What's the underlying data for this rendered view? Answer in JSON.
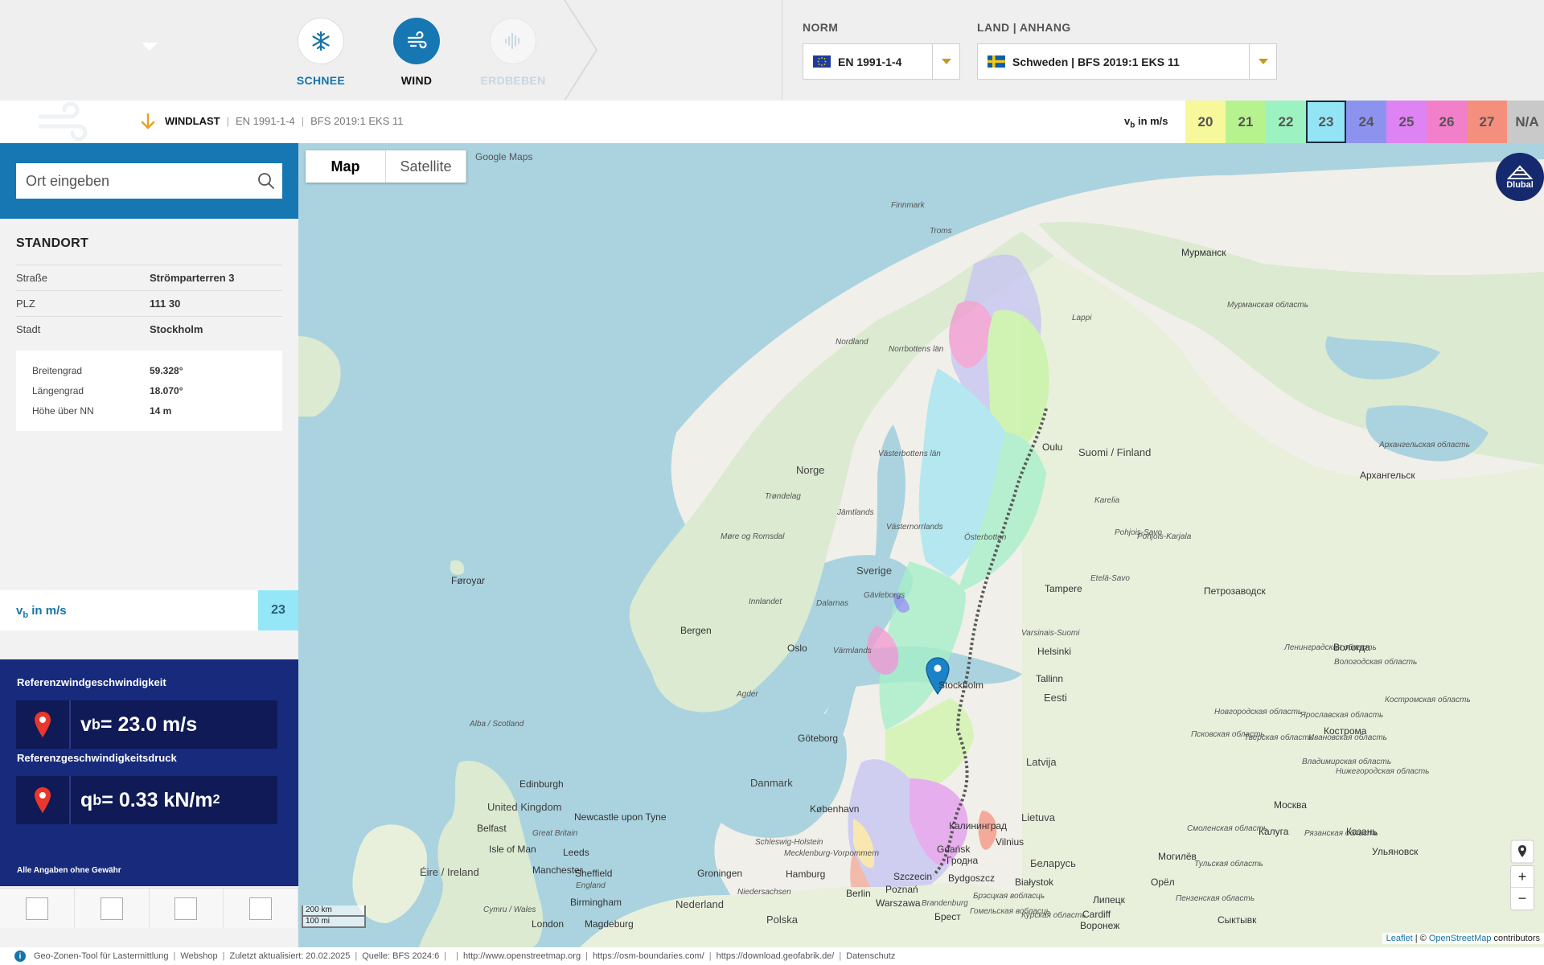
{
  "hazards": [
    {
      "label": "SCHNEE",
      "icon": "snowflake-icon",
      "state": "inactive"
    },
    {
      "label": "WIND",
      "icon": "wind-icon",
      "state": "active"
    },
    {
      "label": "ERDBEBEN",
      "icon": "seismic-icon",
      "state": "disabled"
    }
  ],
  "norm": {
    "caption": "NORM",
    "value": "EN 1991-1-4",
    "flag": "eu-flag-icon"
  },
  "land": {
    "caption": "LAND | ANHANG",
    "value": "Schweden | BFS 2019:1 EKS 11",
    "flag": "sweden-flag-icon"
  },
  "subbar": {
    "title": "WINDLAST",
    "norm": "EN 1991-1-4",
    "annex": "BFS 2019:1 EKS 11",
    "legend_label_v": "v",
    "legend_label_sub": "b",
    "legend_label_unit": " in m/s",
    "legend": [
      {
        "value": "20",
        "color": "#f7f79b"
      },
      {
        "value": "21",
        "color": "#b6f38f"
      },
      {
        "value": "22",
        "color": "#9cf2c0"
      },
      {
        "value": "23",
        "color": "#93e4f5",
        "selected": true
      },
      {
        "value": "24",
        "color": "#8c93ef"
      },
      {
        "value": "25",
        "color": "#de83f3"
      },
      {
        "value": "26",
        "color": "#f27fc9"
      },
      {
        "value": "27",
        "color": "#f48f7d"
      },
      {
        "value": "N/A",
        "color": "#c9c9c9"
      }
    ]
  },
  "search": {
    "placeholder": "Ort eingeben"
  },
  "standort": {
    "title": "STANDORT",
    "address": [
      {
        "key": "Straße",
        "value": "Strömparterren 3"
      },
      {
        "key": "PLZ",
        "value": "111 30"
      },
      {
        "key": "Stadt",
        "value": "Stockholm"
      }
    ],
    "coords": [
      {
        "key": "Breitengrad",
        "value": "59.328°"
      },
      {
        "key": "Längengrad",
        "value": "18.070°"
      },
      {
        "key": "Höhe über NN",
        "value": "14 m"
      }
    ]
  },
  "vb_row": {
    "label_v": "v",
    "label_sub": "b",
    "label_unit": " in m/s",
    "value": "23"
  },
  "results": {
    "title1": "Referenzwindgeschwindigkeit",
    "f1_sym": "v",
    "f1_sub": "b",
    "f1_rest": " = 23.0 m/s",
    "title2": "Referenzgeschwindigkeitsdruck",
    "f2_sym": "q",
    "f2_sub": "b",
    "f2_rest": " = 0.33 kN/m",
    "f2_sup": "2",
    "note": "Alle Angaben ohne Gewähr"
  },
  "map": {
    "tab_map": "Map",
    "tab_sat": "Satellite",
    "google": "Google Maps",
    "dlubal": "Dlubal",
    "scale_km": "200 km",
    "scale_mi": "100 mi",
    "attrib_leaflet": "Leaflet",
    "attrib_sep": " | © ",
    "attrib_osm": "OpenStreetMap",
    "attrib_rest": " contributors",
    "zoom_in": "+",
    "zoom_out": "−",
    "places": [
      {
        "name": "Finnmark",
        "cls": "italic"
      },
      {
        "name": "Troms",
        "cls": "italic"
      },
      {
        "name": "Мурманск",
        "cls": ""
      },
      {
        "name": "Мурманская область",
        "cls": "italic"
      },
      {
        "name": "Lappi",
        "cls": "italic"
      },
      {
        "name": "Nordland",
        "cls": "italic"
      },
      {
        "name": "Norrbottens län",
        "cls": "italic"
      },
      {
        "name": "Oulu",
        "cls": ""
      },
      {
        "name": "Suomi / Finland",
        "cls": "country"
      },
      {
        "name": "Архангельская область",
        "cls": "italic"
      },
      {
        "name": "Архангельск",
        "cls": ""
      },
      {
        "name": "Norge",
        "cls": "country"
      },
      {
        "name": "Västerbottens län",
        "cls": "italic"
      },
      {
        "name": "Trøndelag",
        "cls": "italic"
      },
      {
        "name": "Jämtlands",
        "cls": "italic"
      },
      {
        "name": "Västernorrlands",
        "cls": "italic"
      },
      {
        "name": "Österbotten",
        "cls": "italic"
      },
      {
        "name": "Karelia",
        "cls": "italic"
      },
      {
        "name": "Pohjois-Savo",
        "cls": "italic"
      },
      {
        "name": "Pohjois-Karjala",
        "cls": "italic"
      },
      {
        "name": "Møre og Romsdal",
        "cls": "italic"
      },
      {
        "name": "Sverige",
        "cls": "country"
      },
      {
        "name": "Føroyar",
        "cls": ""
      },
      {
        "name": "Etelä-Savo",
        "cls": "italic"
      },
      {
        "name": "Tampere",
        "cls": ""
      },
      {
        "name": "Петрозаводск",
        "cls": ""
      },
      {
        "name": "Innlandet",
        "cls": "italic"
      },
      {
        "name": "Dalarnas",
        "cls": "italic"
      },
      {
        "name": "Gävleborgs",
        "cls": "italic"
      },
      {
        "name": "Bergen",
        "cls": ""
      },
      {
        "name": "Oslo",
        "cls": ""
      },
      {
        "name": "Värmlands",
        "cls": "italic"
      },
      {
        "name": "Varsinais-Suomi",
        "cls": "italic"
      },
      {
        "name": "Helsinki",
        "cls": ""
      },
      {
        "name": "Ленинградская область",
        "cls": "italic"
      },
      {
        "name": "Вологда",
        "cls": ""
      },
      {
        "name": "Вологодская область",
        "cls": "italic"
      },
      {
        "name": "Tallinn",
        "cls": ""
      },
      {
        "name": "Stockholm",
        "cls": ""
      },
      {
        "name": "Agder",
        "cls": "italic"
      },
      {
        "name": "Eesti",
        "cls": "country"
      },
      {
        "name": "Костромская область",
        "cls": "italic"
      },
      {
        "name": "Новгородская область",
        "cls": "italic"
      },
      {
        "name": "Ярославская область",
        "cls": "italic"
      },
      {
        "name": "Кострома",
        "cls": ""
      },
      {
        "name": "Alba / Scotland",
        "cls": "italic"
      },
      {
        "name": "Göteborg",
        "cls": ""
      },
      {
        "name": "Псковская область",
        "cls": "italic"
      },
      {
        "name": "Тверская область",
        "cls": "italic"
      },
      {
        "name": "Ивановская область",
        "cls": "italic"
      },
      {
        "name": "Latvija",
        "cls": "country"
      },
      {
        "name": "Владимирская область",
        "cls": "italic"
      },
      {
        "name": "Нижегородская область",
        "cls": "italic"
      },
      {
        "name": "Danmark",
        "cls": "country"
      },
      {
        "name": "Edinburgh",
        "cls": ""
      },
      {
        "name": "United Kingdom",
        "cls": "country"
      },
      {
        "name": "Newcastle upon Tyne",
        "cls": ""
      },
      {
        "name": "København",
        "cls": ""
      },
      {
        "name": "Калининград",
        "cls": ""
      },
      {
        "name": "Lietuva",
        "cls": "country"
      },
      {
        "name": "Москва",
        "cls": ""
      },
      {
        "name": "Смоленская область",
        "cls": "italic"
      },
      {
        "name": "Калуга",
        "cls": ""
      },
      {
        "name": "Рязанская область",
        "cls": "italic"
      },
      {
        "name": "Казань",
        "cls": ""
      },
      {
        "name": "Belfast",
        "cls": ""
      },
      {
        "name": "Great Britain",
        "cls": "italic"
      },
      {
        "name": "Isle of Man",
        "cls": ""
      },
      {
        "name": "Schleswig-Holstein",
        "cls": "italic"
      },
      {
        "name": "Gdańsk",
        "cls": ""
      },
      {
        "name": "Vilnius",
        "cls": ""
      },
      {
        "name": "Могилёв",
        "cls": ""
      },
      {
        "name": "Ульяновск",
        "cls": ""
      },
      {
        "name": "Leeds",
        "cls": ""
      },
      {
        "name": "Mecklenburg-Vorpommern",
        "cls": "italic"
      },
      {
        "name": "Гродна",
        "cls": ""
      },
      {
        "name": "Беларусь",
        "cls": "country"
      },
      {
        "name": "Тульская область",
        "cls": "italic"
      },
      {
        "name": "Éire / Ireland",
        "cls": "country"
      },
      {
        "name": "Manchester",
        "cls": ""
      },
      {
        "name": "Sheffield",
        "cls": ""
      },
      {
        "name": "Groningen",
        "cls": ""
      },
      {
        "name": "Hamburg",
        "cls": ""
      },
      {
        "name": "Szczecin",
        "cls": ""
      },
      {
        "name": "Bydgoszcz",
        "cls": ""
      },
      {
        "name": "Białystok",
        "cls": ""
      },
      {
        "name": "Орёл",
        "cls": ""
      },
      {
        "name": "England",
        "cls": "italic"
      },
      {
        "name": "Niedersachsen",
        "cls": "italic"
      },
      {
        "name": "Berlin",
        "cls": ""
      },
      {
        "name": "Poznań",
        "cls": ""
      },
      {
        "name": "Brandenburg",
        "cls": "italic"
      },
      {
        "name": "Брэсцкая вобласць",
        "cls": "italic"
      },
      {
        "name": "Липецк",
        "cls": ""
      },
      {
        "name": "Пензенская область",
        "cls": "italic"
      },
      {
        "name": "Birmingham",
        "cls": ""
      },
      {
        "name": "Cymru / Wales",
        "cls": "italic"
      },
      {
        "name": "Nederland",
        "cls": "country"
      },
      {
        "name": "Warszawa",
        "cls": ""
      },
      {
        "name": "Гомельская вобласць",
        "cls": "italic"
      },
      {
        "name": "Cardiff",
        "cls": ""
      },
      {
        "name": "London",
        "cls": ""
      },
      {
        "name": "Magdeburg",
        "cls": ""
      },
      {
        "name": "Polska",
        "cls": "country"
      },
      {
        "name": "Брест",
        "cls": ""
      },
      {
        "name": "Курская область",
        "cls": "italic"
      },
      {
        "name": "Воронеж",
        "cls": ""
      },
      {
        "name": "Сыктывк",
        "cls": ""
      }
    ]
  },
  "footer": [
    "Geo-Zonen-Tool für Lastermittlung",
    "Webshop",
    "Zuletzt aktualisiert: 20.02.2025",
    "Quelle: BFS 2024:6",
    "",
    "http://www.openstreetmap.org",
    "https://osm-boundaries.com/",
    "https://download.geofabrik.de/",
    "Datenschutz"
  ]
}
